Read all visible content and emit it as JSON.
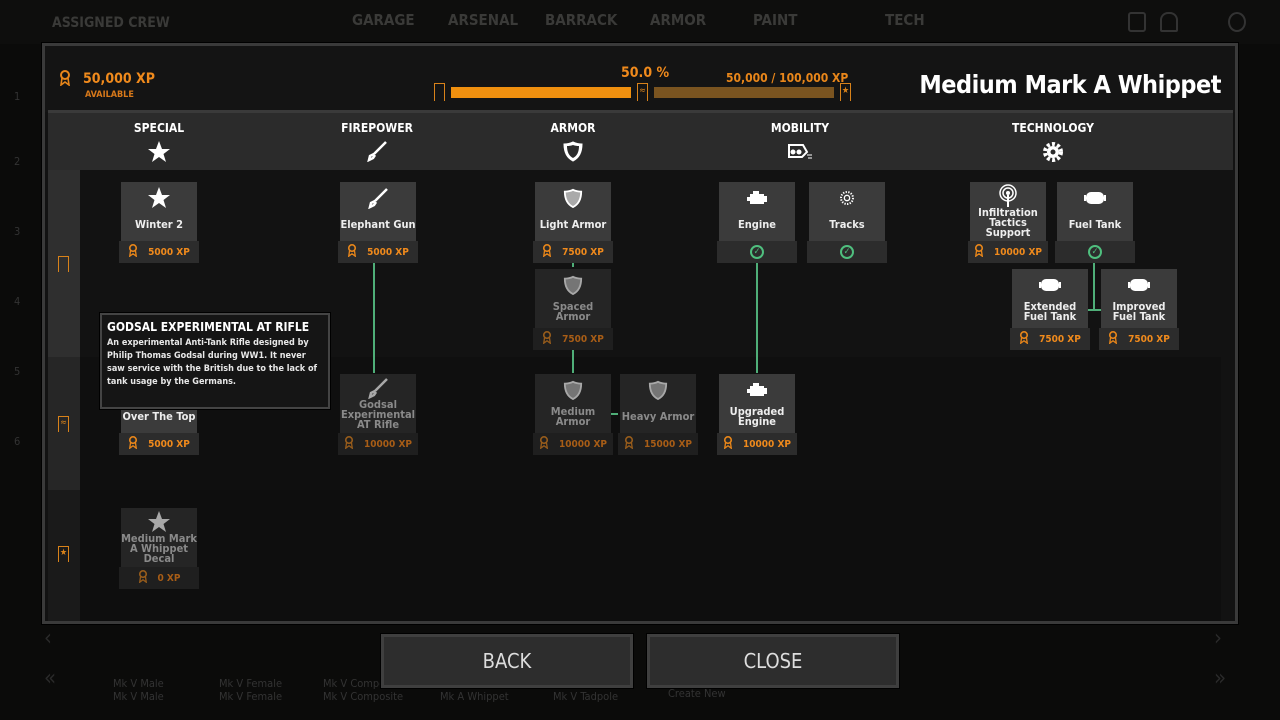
{
  "topnav": {
    "crew": "ASSIGNED CREW",
    "tabs": [
      "GARAGE",
      "ARSENAL",
      "BARRACK",
      "ARMOR",
      "PAINT",
      "TECH"
    ],
    "row_numbers": [
      "1",
      "2",
      "3",
      "4",
      "5",
      "6"
    ]
  },
  "header": {
    "xp_available": "50,000 XP",
    "available_label": "AVAILABLE",
    "progress_percent": "50.0 %",
    "progress_fraction": 0.5,
    "xp_progress": "50,000 / 100,000 XP",
    "vehicle_title": "Medium Mark A Whippet"
  },
  "categories": [
    {
      "label": "SPECIAL",
      "icon": "star-icon"
    },
    {
      "label": "FIREPOWER",
      "icon": "rifle-icon"
    },
    {
      "label": "ARMOR",
      "icon": "shield-icon"
    },
    {
      "label": "MOBILITY",
      "icon": "tank-tracks-icon"
    },
    {
      "label": "TECHNOLOGY",
      "icon": "gear-icon"
    }
  ],
  "tree": {
    "nodes": [
      {
        "id": "winter2",
        "name": "Winter 2",
        "cost": "5000 XP",
        "icon": "star",
        "state": "available"
      },
      {
        "id": "elephant",
        "name": "Elephant Gun",
        "cost": "5000 XP",
        "icon": "rifle",
        "state": "available"
      },
      {
        "id": "light",
        "name": "Light Armor",
        "cost": "7500 XP",
        "icon": "shield",
        "state": "available"
      },
      {
        "id": "spaced",
        "name": "Spaced Armor",
        "cost": "7500 XP",
        "icon": "shield",
        "state": "locked"
      },
      {
        "id": "engine",
        "name": "Engine",
        "cost": "",
        "icon": "engine",
        "state": "owned"
      },
      {
        "id": "tracks",
        "name": "Tracks",
        "cost": "",
        "icon": "gear",
        "state": "owned"
      },
      {
        "id": "infil",
        "name": "Infiltration Tactics Support",
        "cost": "10000 XP",
        "icon": "radio",
        "state": "available"
      },
      {
        "id": "fuel",
        "name": "Fuel Tank",
        "cost": "",
        "icon": "tank",
        "state": "owned"
      },
      {
        "id": "extfuel",
        "name": "Extended Fuel Tank",
        "cost": "7500 XP",
        "icon": "tank",
        "state": "available"
      },
      {
        "id": "impfuel",
        "name": "Improved Fuel Tank",
        "cost": "7500 XP",
        "icon": "tank",
        "state": "available"
      },
      {
        "id": "overtop",
        "name": "Over The Top",
        "cost": "5000 XP",
        "icon": "star",
        "state": "available"
      },
      {
        "id": "godsal",
        "name": "Godsal Experimental AT Rifle",
        "cost": "10000 XP",
        "icon": "rifle",
        "state": "locked"
      },
      {
        "id": "medium",
        "name": "Medium Armor",
        "cost": "10000 XP",
        "icon": "shield",
        "state": "locked"
      },
      {
        "id": "heavy",
        "name": "Heavy Armor",
        "cost": "15000 XP",
        "icon": "shield",
        "state": "locked"
      },
      {
        "id": "upengine",
        "name": "Upgraded Engine",
        "cost": "10000 XP",
        "icon": "engine",
        "state": "available"
      },
      {
        "id": "decal",
        "name": "Medium Mark A Whippet Decal",
        "cost": "0 XP",
        "icon": "star",
        "state": "locked"
      }
    ]
  },
  "tooltip": {
    "title": "GODSAL EXPERIMENTAL AT RIFLE",
    "body": "An experimental Anti-Tank Rifle designed by Philip Thomas Godsal during WW1. It never saw service with the British due to the lack of tank usage by the Germans."
  },
  "buttons": {
    "back": "BACK",
    "close": "CLOSE"
  },
  "vehicle_bar": [
    "Mk V Male",
    "Mk V Male",
    "Mk V Female",
    "Mk V Female",
    "Mk V Composite",
    "Mk V Composite",
    "Mk A Whippet",
    "Mk V Tadpole",
    "Create New"
  ],
  "colors": {
    "accent": "#f08a1c",
    "unlocked_line": "#4fae78"
  }
}
